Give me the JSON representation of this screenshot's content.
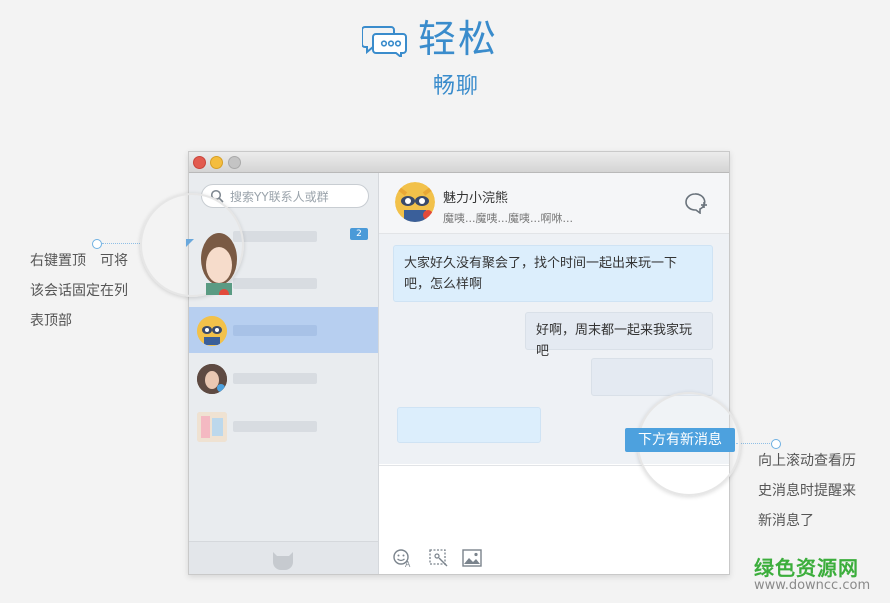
{
  "hero": {
    "title": "轻松",
    "subtitle": "畅聊",
    "icon": "chat-bubbles-icon"
  },
  "callouts": {
    "left": [
      "右键置顶　可将",
      "该会话固定在列",
      "表顶部"
    ],
    "right": [
      "向上滚动查看历",
      "史消息时提醒来",
      "新消息了"
    ]
  },
  "sidebar": {
    "search_placeholder": "搜索YY联系人或群",
    "contacts": [
      {
        "avatar": "girl-avatar",
        "badge": "2"
      },
      {
        "avatar": "raccoon-avatar",
        "selected": true
      },
      {
        "avatar": "photo-avatar"
      },
      {
        "avatar": "cartoon-avatar"
      }
    ]
  },
  "chat": {
    "name": "魅力小浣熊",
    "status": "魔咦...魔咦...魔咦...啊咻...",
    "messages": [
      {
        "side": "left",
        "text": "大家好久没有聚会了，找个时间一起出来玩一下吧，怎么样啊"
      },
      {
        "side": "right",
        "text": "好啊，周末都一起来我家玩吧"
      },
      {
        "side": "right",
        "text": ""
      },
      {
        "side": "left",
        "text": ""
      }
    ],
    "new_message_hint": "下方有新消息",
    "tools": [
      "emoji-icon",
      "screenshot-icon",
      "image-icon"
    ]
  },
  "colors": {
    "accent": "#3a8ccc",
    "selected": "#b7cff0",
    "bubble_left": "#dceefc",
    "bubble_right": "#e4eaf2"
  },
  "watermark": {
    "cn": "绿色资源网",
    "url": "www.downcc.com"
  }
}
